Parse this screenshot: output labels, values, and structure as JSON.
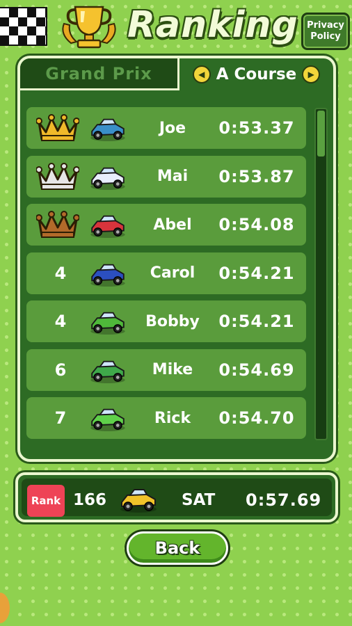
{
  "header": {
    "title": "Ranking",
    "privacy_label_line1": "Privacy",
    "privacy_label_line2": "Policy"
  },
  "tabs": {
    "grand_prix": "Grand Prix",
    "course": "A Course",
    "prev_icon": "left-triangle-icon",
    "next_icon": "right-triangle-icon"
  },
  "ranking": [
    {
      "rank": "1",
      "badge": "gold-crown",
      "car": "blue-monster-truck",
      "car_color": "#3a8fc9",
      "name": "Joe",
      "time": "0:53.37"
    },
    {
      "rank": "2",
      "badge": "silver-crown",
      "car": "white-racer",
      "car_color": "#e8eefc",
      "name": "Mai",
      "time": "0:53.87"
    },
    {
      "rank": "3",
      "badge": "bronze-crown",
      "car": "red-buggy",
      "car_color": "#d8343c",
      "name": "Abel",
      "time": "0:54.08"
    },
    {
      "rank": "4",
      "badge": "",
      "car": "blue-sports-car",
      "car_color": "#2b4fc0",
      "name": "Carol",
      "time": "0:54.21"
    },
    {
      "rank": "4",
      "badge": "",
      "car": "green-buggy",
      "car_color": "#4fb83a",
      "name": "Bobby",
      "time": "0:54.21"
    },
    {
      "rank": "6",
      "badge": "",
      "car": "green-buggy",
      "car_color": "#3fa84a",
      "name": "Mike",
      "time": "0:54.69"
    },
    {
      "rank": "7",
      "badge": "",
      "car": "green-racer",
      "car_color": "#5fd04a",
      "name": "Rick",
      "time": "0:54.70"
    }
  ],
  "player": {
    "badge": "Rank",
    "rank": "166",
    "car": "yellow-buggy",
    "car_color": "#f0c22a",
    "name": "SAT",
    "time": "0:57.69"
  },
  "back_label": "Back",
  "scroll_fraction": 0.12,
  "colors": {
    "gold": "#f0b92a",
    "silver": "#e6e6e6",
    "bronze": "#b26a2a",
    "rank_badge": "#ee4356"
  }
}
